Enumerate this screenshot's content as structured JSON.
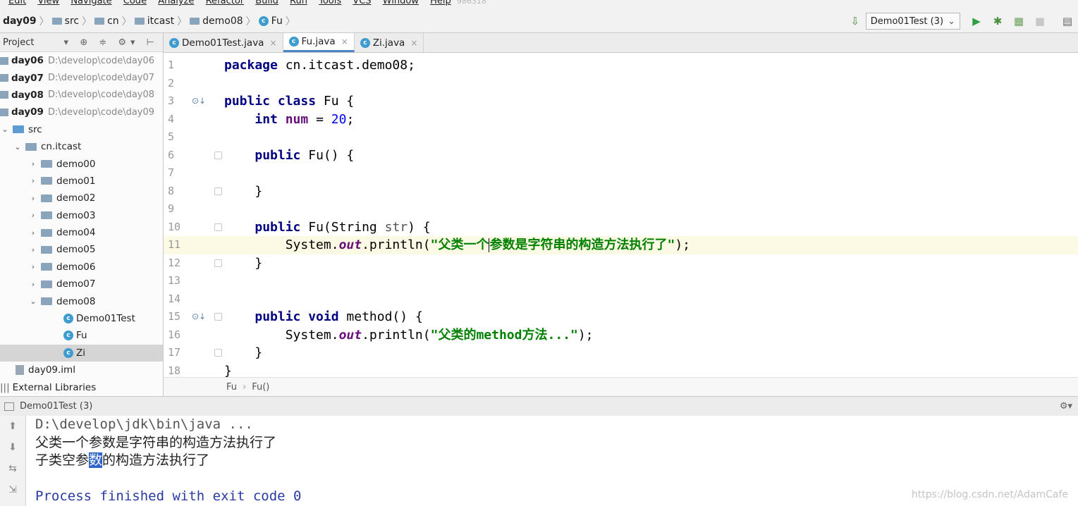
{
  "menu": [
    "Edit",
    "View",
    "Navigate",
    "Code",
    "Analyze",
    "Refactor",
    "Build",
    "Run",
    "Tools",
    "VCS",
    "Window",
    "Help"
  ],
  "menu_ghost": "986318",
  "breadcrumb": [
    "day09",
    "src",
    "cn",
    "itcast",
    "demo08",
    "Fu"
  ],
  "run_config": "Demo01Test (3)",
  "project": {
    "title": "Project",
    "rows": [
      {
        "label": "day06",
        "path": "D:\\develop\\code\\day06"
      },
      {
        "label": "day07",
        "path": "D:\\develop\\code\\day07"
      },
      {
        "label": "day08",
        "path": "D:\\develop\\code\\day08"
      },
      {
        "label": "day09",
        "path": "D:\\develop\\code\\day09"
      },
      {
        "label": "src"
      },
      {
        "label": "cn.itcast"
      },
      {
        "label": "demo00"
      },
      {
        "label": "demo01"
      },
      {
        "label": "demo02"
      },
      {
        "label": "demo03"
      },
      {
        "label": "demo04"
      },
      {
        "label": "demo05"
      },
      {
        "label": "demo06"
      },
      {
        "label": "demo07"
      },
      {
        "label": "demo08"
      },
      {
        "label": "Demo01Test"
      },
      {
        "label": "Fu"
      },
      {
        "label": "Zi"
      },
      {
        "label": "day09.iml"
      },
      {
        "label": "External Libraries"
      }
    ]
  },
  "tabs": [
    "Demo01Test.java",
    "Fu.java",
    "Zi.java"
  ],
  "code": {
    "l1_kw": "package",
    "l1_rest": " cn.itcast.demo08;",
    "l3_kw": "public class",
    "l3_rest": " Fu {",
    "l4_kw": "int",
    "l4_field": "num",
    "l4_eq": " = ",
    "l4_num": "20",
    "l4_end": ";",
    "l6_kw": "public",
    "l6_rest": " Fu() {",
    "l8": "}",
    "l10_kw": "public",
    "l10_a": " Fu(String ",
    "l10_param": "str",
    "l10_b": ") {",
    "l11_a": "System.",
    "l11_out": "out",
    "l11_b": ".println(",
    "l11_str1": "\"父类一个",
    "l11_str2": "参数是字符串的构造方法执行了\"",
    "l11_end": ");",
    "l12": "}",
    "l15_kw": "public void",
    "l15_rest": " method() {",
    "l16_a": "System.",
    "l16_out": "out",
    "l16_b": ".println(",
    "l16_str": "\"父类的method方法...\"",
    "l16_end": ");",
    "l17": "}",
    "l18": "}"
  },
  "line_numbers": [
    "1",
    "2",
    "3",
    "4",
    "5",
    "6",
    "7",
    "8",
    "9",
    "10",
    "11",
    "12",
    "13",
    "14",
    "15",
    "16",
    "17",
    "18"
  ],
  "editor_breadcrumb": [
    "Fu",
    "Fu()"
  ],
  "run_panel": {
    "title": "Demo01Test (3)",
    "cmd": "D:\\develop\\jdk\\bin\\java ...",
    "out1": "父类一个参数是字符串的构造方法执行了",
    "out2_a": "子类空参",
    "out2_sel": "数",
    "out2_b": "的构造方法执行了",
    "finish": "Process finished with exit code 0"
  },
  "watermark": "https://blog.csdn.net/AdamCafe"
}
